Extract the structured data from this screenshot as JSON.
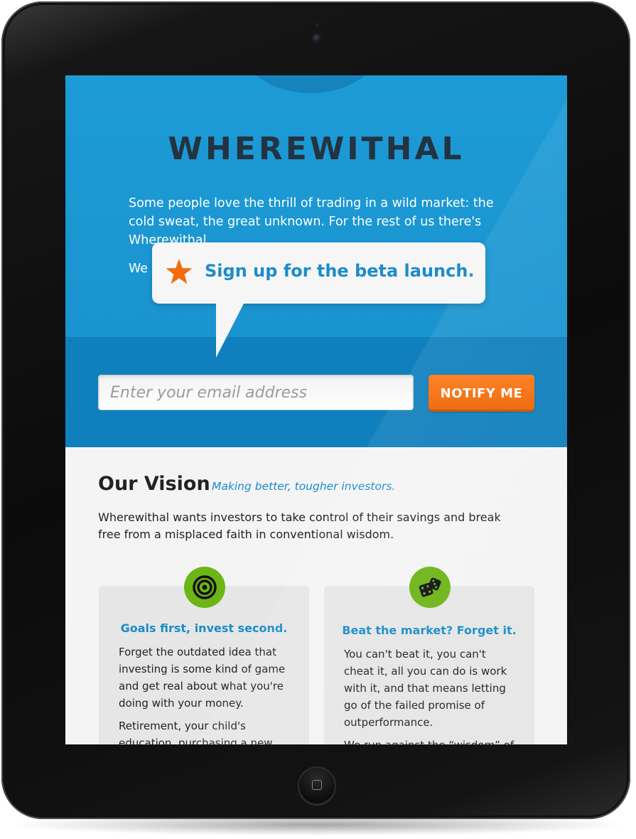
{
  "brand": {
    "logo": "WHEREWITHAL"
  },
  "hero": {
    "paragraph_1": "Some people love the thrill of trading in a wild market: the cold sweat, the great unknown.  For the rest of us there's Wherewithal.",
    "paragraph_2": "We"
  },
  "tooltip": {
    "icon": "star-icon",
    "text": "Sign up for the beta launch.",
    "icon_color": "#f26c0d"
  },
  "signup": {
    "email_placeholder": "Enter your email address",
    "email_value": "",
    "button_label": "NOTIFY ME"
  },
  "vision": {
    "title": "Our Vision",
    "tagline": "Making better, tougher investors.",
    "description": "Wherewithal wants investors to take control of their savings and break free from a misplaced faith in conventional wisdom."
  },
  "cards": [
    {
      "icon": "target-icon",
      "title": "Goals first, invest second.",
      "paragraphs": [
        "Forget the outdated idea that investing is some kind of game and get real about what you're doing with your money.",
        "Retirement, your child's education, purchasing a new"
      ]
    },
    {
      "icon": "dice-icon",
      "title": "Beat the market? Forget it.",
      "paragraphs": [
        "You can't beat it, you can't cheat it, all you can do is work with it, and that means letting go of the failed promise of outperformance.",
        "We run against the “wisdom” of"
      ]
    }
  ],
  "colors": {
    "hero_blue": "#1d9bd6",
    "band_blue": "#0f7fbd",
    "accent_orange": "#f26c0d",
    "icon_green": "#6cb516",
    "link_blue": "#1a8cc9"
  }
}
